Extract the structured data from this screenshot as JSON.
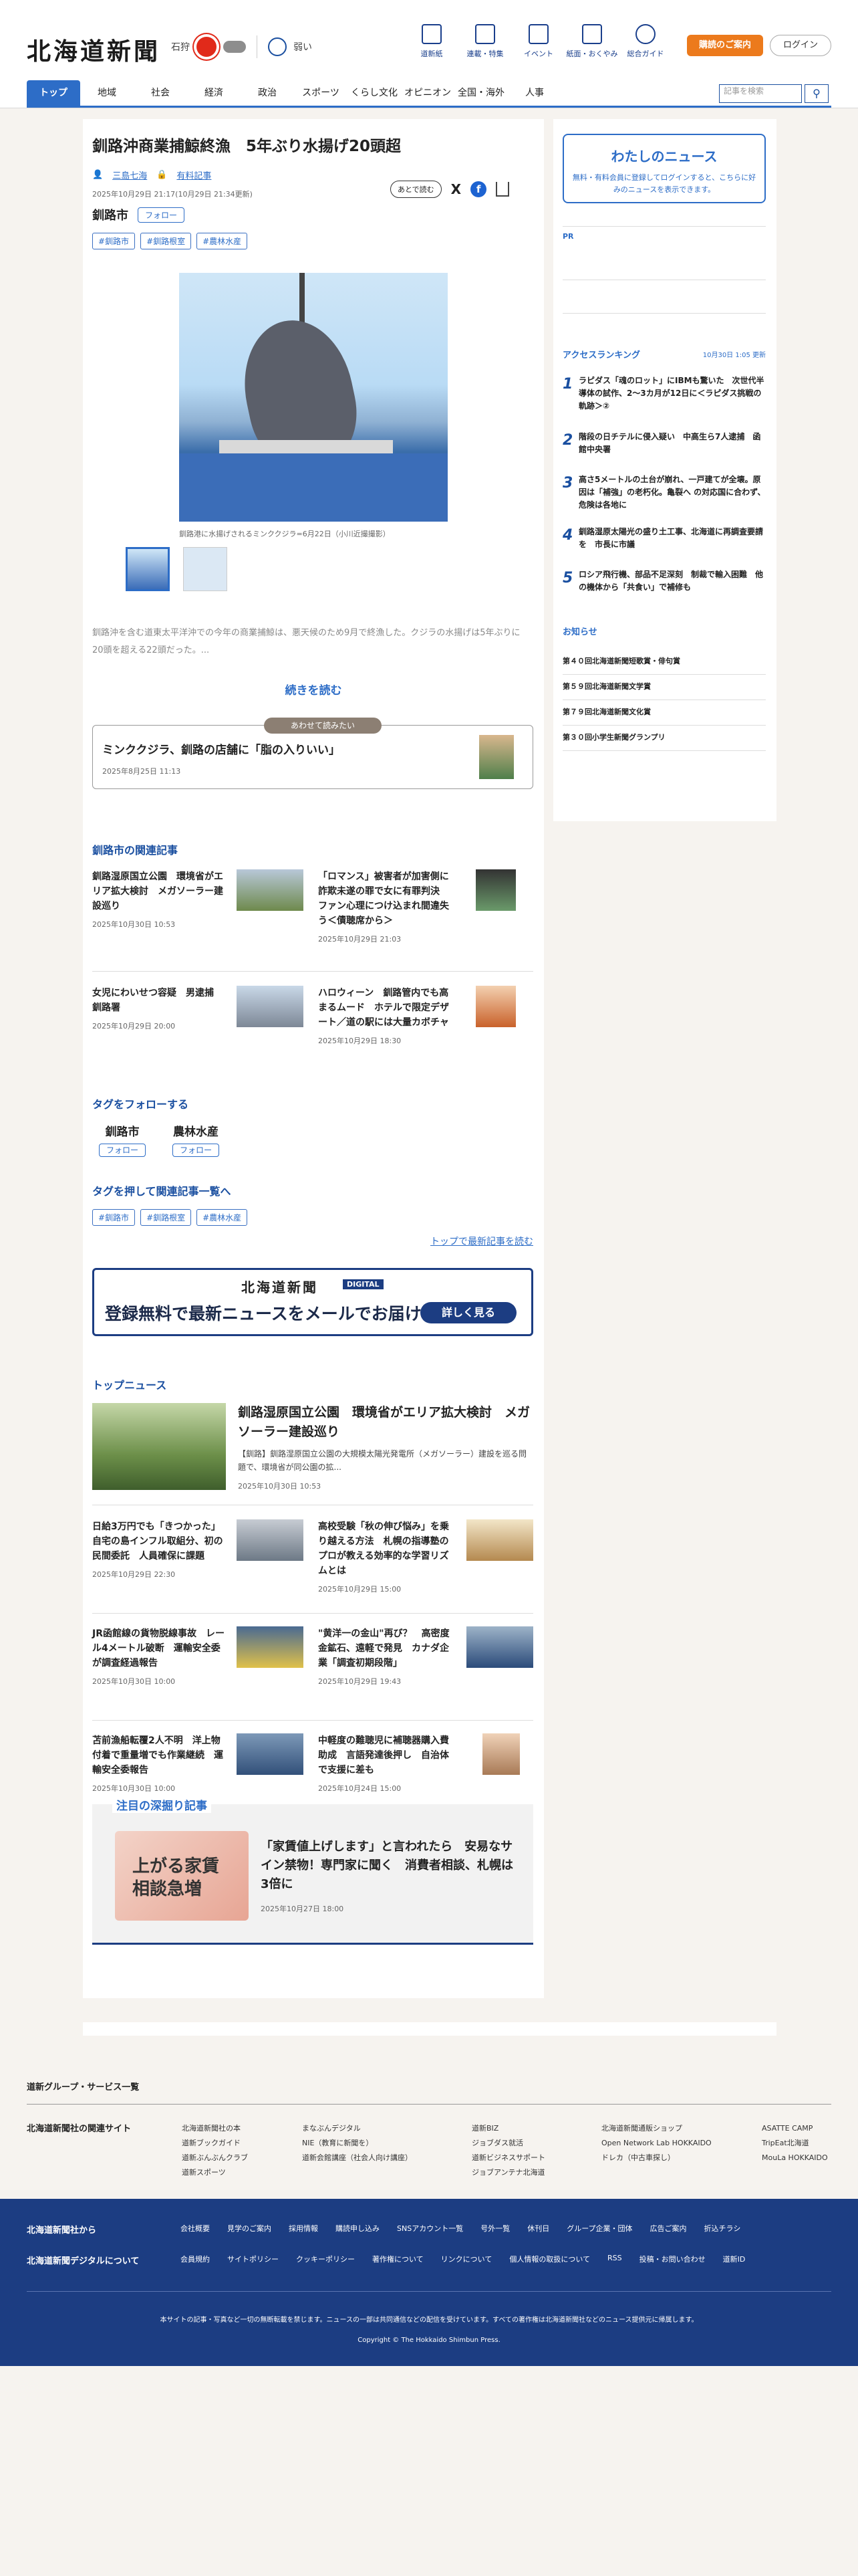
{
  "header": {
    "logo": "北海道新聞",
    "weather": {
      "city": "石狩",
      "uv_label": "弱い"
    },
    "tools": [
      "道新紙",
      "連載・特集",
      "イベント",
      "紙面・おくやみ",
      "総合ガイド"
    ],
    "subscribe_label": "購読のご案内",
    "login_label": "ログイン",
    "search_placeholder": "記事を検索",
    "nav": [
      "トップ",
      "地域",
      "社会",
      "経済",
      "政治",
      "スポーツ",
      "くらし文化",
      "オピニオン",
      "全国・海外",
      "人事"
    ]
  },
  "article": {
    "title": "釧路沖商業捕鯨終漁　5年ぶり水揚げ20頭超",
    "author": "三島七海",
    "author_badge": "有料記事",
    "date": "2025年10月29日 21:17(10月29日 21:34更新)",
    "save_label": "あとで読む",
    "city": "釧路市",
    "follow_label": "フォロー",
    "tags": [
      "#釧路市",
      "#釧路根室",
      "#農林水産"
    ],
    "caption": "釧路港に水揚げされるミンククジラ=6月22日（小川近撮撮影）",
    "lead": "釧路沖を含む道東太平洋沖での今年の商業捕鯨は、悪天候のため9月で終漁した。クジラの水揚げは5年ぶりに20頭を超える22頭だった。...",
    "more_label": "続きを読む"
  },
  "recommend": {
    "pill": "あわせて読みたい",
    "title": "ミンククジラ、釧路の店舗に「脂の入りいい」",
    "date": "2025年8月25日 11:13"
  },
  "related": {
    "heading": "釧路市の関連記事",
    "items": [
      {
        "title": "釧路湿原国立公園　環境省がエリア拡大検討　メガソーラー建設巡り",
        "date": "2025年10月30日 10:53"
      },
      {
        "title": "「ロマンス」被害者が加害側に　詐欺未遂の罪で女に有罪判決　ファン心理につけ込まれ間違失う＜債聴席から＞",
        "date": "2025年10月29日 21:03"
      },
      {
        "title": "女児にわいせつ容疑　男逮捕　釧路署",
        "date": "2025年10月29日 20:00"
      },
      {
        "title": "ハロウィーン　釧路管内でも高まるムード　ホテルで限定デザート／道の駅には大量カボチャ",
        "date": "2025年10月29日 18:30"
      }
    ]
  },
  "follow_tags": {
    "heading": "タグをフォローする",
    "items": [
      "釧路市",
      "農林水産"
    ],
    "button": "フォロー"
  },
  "tag_search": {
    "heading": "タグを押して関連記事一覧へ",
    "tags": [
      "#釧路市",
      "#釧路根室",
      "#農林水産"
    ],
    "latest_link": "トップで最新記事を読む"
  },
  "banner": {
    "masthead": "北海道新聞",
    "digital": "DIGITAL",
    "message": "登録無料で最新ニュースをメールでお届け",
    "button": "詳しく見る"
  },
  "top_news": {
    "heading": "トップニュース",
    "lead": {
      "title": "釧路湿原国立公園　環境省がエリア拡大検討　メガソーラー建設巡り",
      "summary": "【釧路】釧路湿原国立公園の大規模太陽光発電所（メガソーラー）建設を巡る問題で、環境省が同公園の拡...",
      "date": "2025年10月30日 10:53"
    },
    "items": [
      {
        "title": "日給3万円でも「きつかった」 自宅の島インフル取組分、初の民間委託　人員確保に課題",
        "date": "2025年10月29日 22:30"
      },
      {
        "title": "高校受験「秋の伸び悩み」を乗り越える方法　札幌の指導塾のプロが教える効率的な学習リズムとは",
        "date": "2025年10月29日 15:00"
      },
      {
        "title": "JR函館線の貨物脱線事故　レール4メートル破断　運輸安全委が調査経過報告",
        "date": "2025年10月30日 10:00"
      },
      {
        "title": "\"黄洋一の金山\"再び？　高密度金鉱石、遠軽で発見　カナダ企業「調査初期段階」",
        "date": "2025年10月29日 19:43"
      },
      {
        "title": "苫前漁船転覆2人不明　洋上物付着で重量増でも作業継続　運輸安全委報告",
        "date": "2025年10月30日 10:00"
      },
      {
        "title": "中軽度の難聴児に補聴器購入費助成　言語発達後押し　自治体で支援に差も",
        "date": "2025年10月24日 15:00"
      }
    ]
  },
  "deep": {
    "heading": "注目の深掘り記事",
    "image_text": "上がる家賃相談急増",
    "title": "「家賃値上げします」と言われたら　安易なサイン禁物！専門家に聞く　消費者相談、札幌は3倍に",
    "date": "2025年10月27日 18:00"
  },
  "sidebar": {
    "mynews_title": "わたしのニュース",
    "mynews_text": "無料・有料会員に登録してログインすると、こちらに好みのニュースを表示できます。",
    "pr": "PR",
    "ranking_heading": "アクセスランキング",
    "ranking_updated": "10月30日 1:05 更新",
    "ranking": [
      "ラピダス「魂のロット」にIBMも驚いた　次世代半導体の試作、2〜3カ月が12日に＜ラピダス挑戦の軌跡＞②",
      "階段の日チテルに侵入疑い　中高生ら7人逮捕　函館中央署",
      "高さ5メートルの土台が崩れ、一戸建てが全壊。原因は「補強」の老朽化。亀裂へ の対応国に合わず、危険は各地に",
      "釧路湿原太陽光の盛り土工事、北海道に再調査要請を　市長に市議",
      "ロシア飛行機、部品不足深刻　制裁で輸入困難　他の機体から「共食い」で補修も"
    ],
    "notice_heading": "お知らせ",
    "notices": [
      "第４０回北海道新聞短歌賞・俳句賞",
      "第５９回北海道新聞文学賞",
      "第７９回北海道新聞文化賞",
      "第３０回小学生新聞グランプリ"
    ]
  },
  "footer": {
    "group_label": "道新グループ・サービス一覧",
    "related_heading": "北海道新聞社の関連サイト",
    "cols": [
      [
        "北海道新聞社の本",
        "道新ブックガイド",
        "道新ぶんぶんクラブ",
        "道新スポーツ"
      ],
      [
        "まなぶんデジタル",
        "NIE（教育に新聞を）",
        "道新会館講座（社会人向け講座）"
      ],
      [
        "道新BIZ",
        "ジョブダス就活",
        "道新ビジネスサポート",
        "ジョブアンテナ北海道"
      ],
      [
        "北海道新聞通販ショップ",
        "Open Network Lab HOKKAIDO",
        "ドレカ（中古車探し）"
      ],
      [
        "ASATTE CAMP",
        "TripEat北海道",
        "MouLa HOKKAIDO"
      ]
    ],
    "from_label": "北海道新聞社から",
    "from_links": [
      "会社概要",
      "見学のご案内",
      "採用情報",
      "購読申し込み",
      "SNSアカウント一覧",
      "号外一覧",
      "休刊日",
      "グループ企業・団体",
      "広告ご案内",
      "折込チラシ"
    ],
    "digital_label": "北海道新聞デジタルについて",
    "digital_links": [
      "会員規約",
      "サイトポリシー",
      "クッキーポリシー",
      "著作権について",
      "リンクについて",
      "個人情報の取扱について",
      "RSS",
      "投稿・お問い合わせ",
      "道新ID"
    ],
    "note": "本サイトの記事・写真など一切の無断転載を禁じます。ニュースの一部は共同通信などの配信を受けています。すべての著作権は北海道新聞社などのニュース提供元に帰属します。",
    "copyright": "Copyright © The Hokkaido Shimbun Press."
  },
  "colors": {
    "accent": "#2d6dc7",
    "navy": "#1c3d82",
    "orange": "#ec7a1c"
  }
}
